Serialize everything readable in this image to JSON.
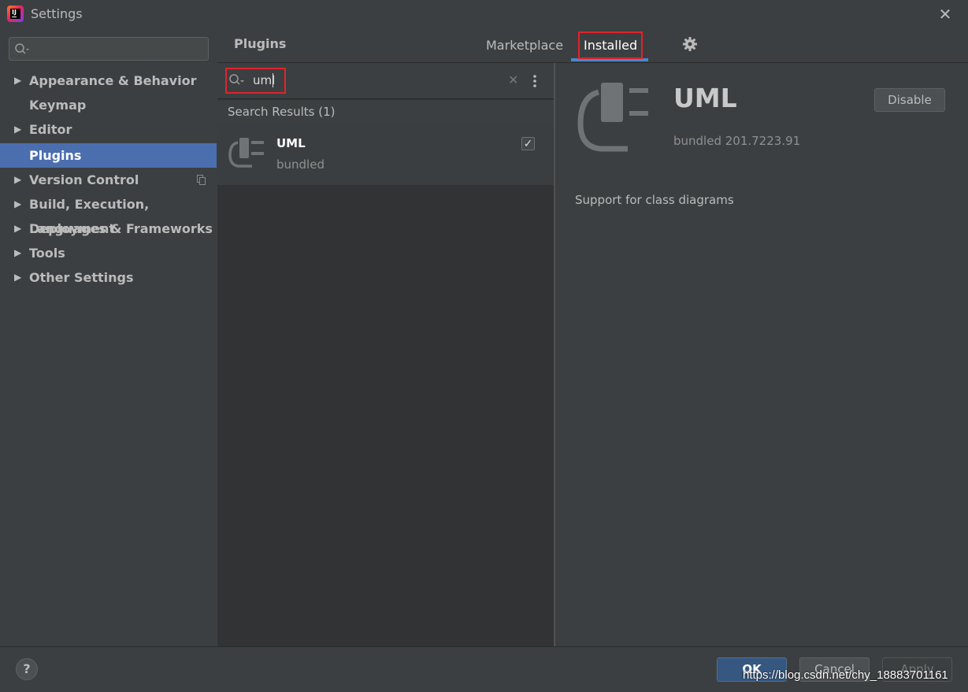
{
  "window": {
    "title": "Settings",
    "close_glyph": "✕"
  },
  "sidebar": {
    "items": [
      {
        "label": "Appearance & Behavior",
        "expandable": true
      },
      {
        "label": "Keymap",
        "expandable": false
      },
      {
        "label": "Editor",
        "expandable": true
      },
      {
        "label": "Plugins",
        "expandable": false,
        "selected": true
      },
      {
        "label": "Version Control",
        "expandable": true
      },
      {
        "label": "Build, Execution, Deployment",
        "expandable": true
      },
      {
        "label": "Languages & Frameworks",
        "expandable": true
      },
      {
        "label": "Tools",
        "expandable": true
      },
      {
        "label": "Other Settings",
        "expandable": true
      }
    ]
  },
  "header": {
    "title": "Plugins",
    "tabs": [
      {
        "label": "Marketplace"
      },
      {
        "label": "Installed",
        "active": true
      }
    ]
  },
  "plugin_list": {
    "search_value": "uml",
    "results_label": "Search Results (1)",
    "results": [
      {
        "name": "UML",
        "subtitle": "bundled",
        "enabled": true,
        "check_glyph": "✓"
      }
    ]
  },
  "detail": {
    "name": "UML",
    "version": "bundled 201.7223.91",
    "disable_label": "Disable",
    "description": "Support for class diagrams"
  },
  "footer": {
    "help_label": "?",
    "ok_label": "OK",
    "cancel_label": "Cancel",
    "apply_label": "Apply"
  },
  "watermark": "https://blog.csdn.net/chy_18883701161",
  "colors": {
    "selection": "#4b6eaf",
    "highlight_box": "#e0232c",
    "tab_underline": "#4a88c7",
    "ok_button": "#365880"
  },
  "icons": [
    "intellij-logo-icon",
    "close-icon",
    "search-icon",
    "gear-icon",
    "more-vertical-icon",
    "plugin-plug-icon",
    "checkbox-checked-icon",
    "help-icon",
    "copy-icon"
  ]
}
